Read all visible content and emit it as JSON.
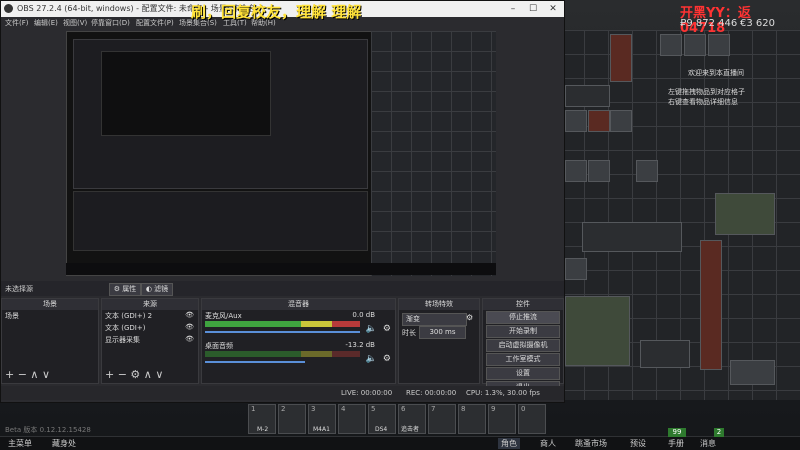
{
  "overlay": {
    "danmaku": "刷，回复校友，理解 理解",
    "hud_top_right": "开黑YY：返 04718",
    "top_money_1": "₽9 872 446",
    "top_money_2": "€3 620",
    "chat_lines": [
      "欢迎来到本直播间",
      "左键拖拽物品到对应格子",
      "右键查看物品详细信息"
    ]
  },
  "obs": {
    "title": "OBS 27.2.4 (64-bit, windows) - 配置文件: 未命名 - 场景: 未命名",
    "menu": [
      "文件(F)",
      "编辑(E)",
      "视图(V)",
      "停靠窗口(D)",
      "配置文件(P)",
      "场景集合(S)",
      "工具(T)",
      "帮助(H)"
    ],
    "no_source": "未选择源",
    "properties_btn": "属性",
    "filters_btn": "滤镜",
    "scenes": {
      "title": "场景",
      "items": [
        "场景"
      ]
    },
    "sources": {
      "title": "来源",
      "items": [
        "文本 (GDI+) 2",
        "文本 (GDI+)",
        "显示器采集"
      ]
    },
    "mixer": {
      "title": "混音器",
      "channels": [
        {
          "name": "麦克风/Aux",
          "db": "0.0 dB",
          "level": 0.78
        },
        {
          "name": "桌面音频",
          "db": "-13.2 dB",
          "level": 0.55
        }
      ]
    },
    "transitions": {
      "title": "转场特效",
      "type": "渐变",
      "duration_label": "时长",
      "duration": "300 ms"
    },
    "controls": {
      "title": "控件",
      "buttons": [
        "停止推流",
        "开始录制",
        "启动虚拟摄像机",
        "工作室模式",
        "设置",
        "退出"
      ]
    },
    "status": {
      "live": "LIVE: 00:00:00",
      "rec": "REC: 00:00:00",
      "cpu": "CPU: 1.3%, 30.00 fps"
    }
  },
  "game": {
    "slots": [
      "M-2",
      "M4A1",
      "DS4",
      "追击者",
      "",
      "",
      "",
      "",
      "",
      ""
    ],
    "stash_label": "Beta 版本 0.12.12.15428",
    "nav": [
      "主菜单",
      "藏身处",
      "角色",
      "商人",
      "跳蚤市场",
      "预设",
      "手册",
      "消息"
    ],
    "badges": [
      "99",
      "2"
    ]
  }
}
